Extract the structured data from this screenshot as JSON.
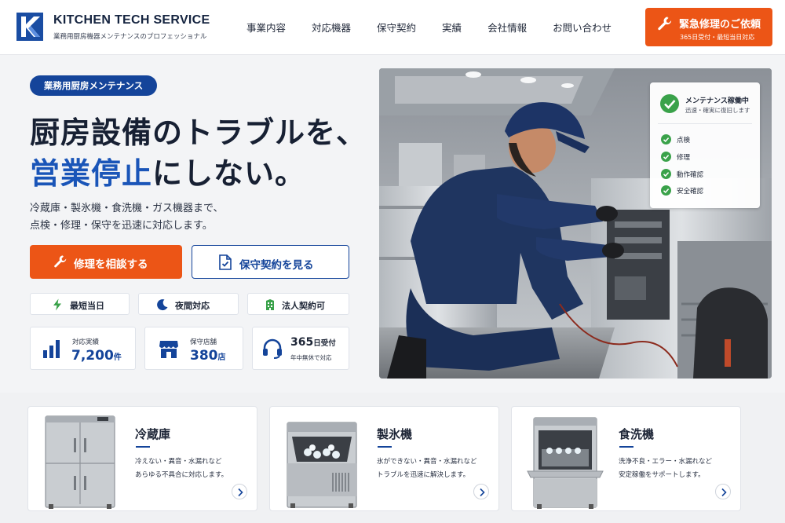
{
  "brand": {
    "name": "KITCHEN TECH SERVICE",
    "tagline": "業務用厨房機器メンテナンスのプロフェッショナル"
  },
  "nav": {
    "items": [
      "事業内容",
      "対応機器",
      "保守契約",
      "実績",
      "会社情報",
      "お問い合わせ"
    ]
  },
  "header_cta": {
    "title": "緊急修理のご依頼",
    "subtitle": "365日受付・最短当日対応"
  },
  "hero": {
    "badge": "業務用厨房メンテナンス",
    "headline_line1": "厨房設備のトラブルを、",
    "headline_line2_highlight": "営業停止",
    "headline_line2_rest": "にしない。",
    "sub_line1": "冷蔵庫・製氷機・食洗機・ガス機器まで、",
    "sub_line2": "点検・修理・保守を迅速に対応します。",
    "primary_button": "修理を相談する",
    "secondary_button": "保守契約を見る",
    "features": [
      "最短当日",
      "夜間対応",
      "法人契約可"
    ],
    "stats": [
      {
        "label": "対応実績",
        "value": "7,200",
        "unit": "件"
      },
      {
        "label": "保守店舗",
        "value": "380",
        "unit": "店"
      },
      {
        "label": "年中無休で対応",
        "value": "365",
        "unit": "日受付"
      }
    ]
  },
  "status_card": {
    "title": "メンテナンス稼働中",
    "subtitle": "迅速・確実に復旧します",
    "items": [
      "点検",
      "修理",
      "動作確認",
      "安全確認"
    ]
  },
  "products": [
    {
      "title": "冷蔵庫",
      "desc_line1": "冷えない・異音・水漏れなど",
      "desc_line2": "あらゆる不具合に対応します。"
    },
    {
      "title": "製氷機",
      "desc_line1": "氷ができない・異音・水漏れなど",
      "desc_line2": "トラブルを迅速に解決します。"
    },
    {
      "title": "食洗機",
      "desc_line1": "洗浄不良・エラー・水漏れなど",
      "desc_line2": "安定稼働をサポートします。"
    }
  ],
  "colors": {
    "brand_navy": "#14449a",
    "accent_orange": "#ec5516",
    "check_green": "#3aa24a"
  }
}
